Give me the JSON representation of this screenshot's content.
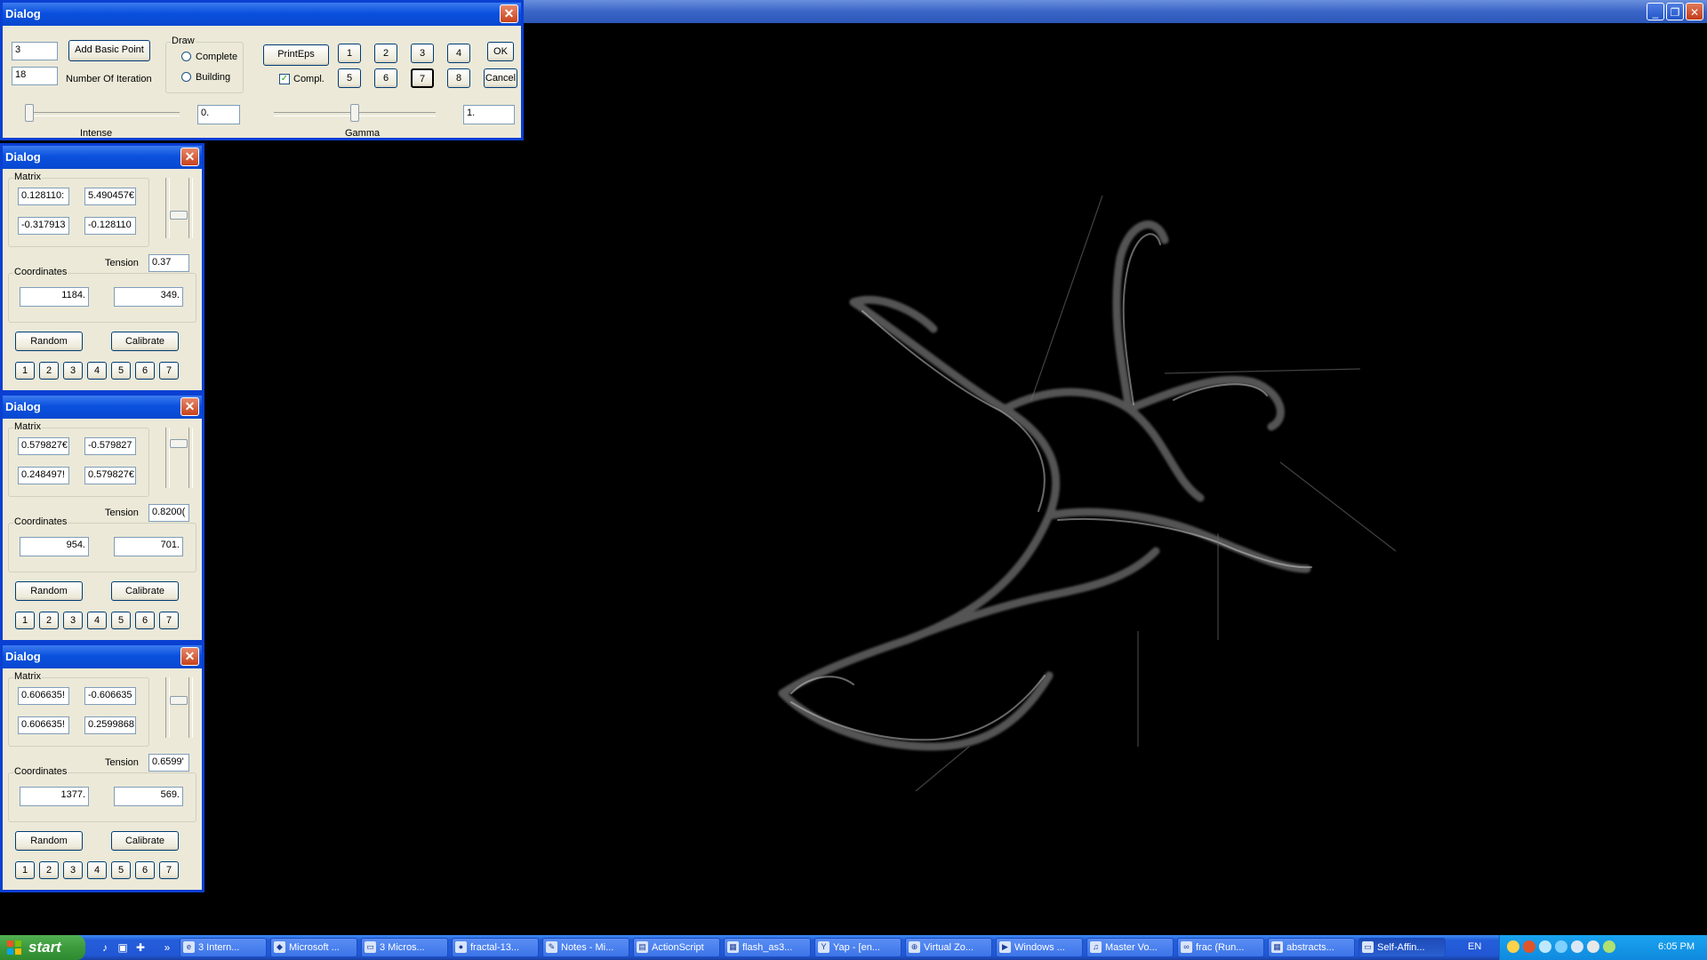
{
  "main_window": {
    "buttons": [
      "minimize",
      "maximize",
      "close"
    ],
    "minimize_glyph": "_",
    "maximize_glyph": "❐",
    "close_glyph": "✕"
  },
  "top_dialog": {
    "title": "Dialog",
    "basic_points_value": "3",
    "iterations_value": "18",
    "add_basic_point_label": "Add Basic Point",
    "number_of_iteration_label": "Number Of Iteration",
    "draw_group_label": "Draw",
    "complete_label": "Complete",
    "building_label": "Building",
    "print_eps_label": "PrintEps",
    "compl_label": "Compl.",
    "compl_checked": true,
    "number_buttons": [
      "1",
      "2",
      "3",
      "4",
      "5",
      "6",
      "7",
      "8"
    ],
    "pressed_number": "7",
    "ok_label": "OK",
    "cancel_label": "Cancel",
    "intense_value": "0.",
    "intense_label": "Intense",
    "intense_level": 0.0,
    "gamma_value": "1.",
    "gamma_label": "Gamma",
    "gamma_level": 0.5
  },
  "side_dialogs": [
    {
      "title": "Dialog",
      "matrix_label": "Matrix",
      "m11": "0.128110:",
      "m12": "5.490457€",
      "m21": "-0.317913",
      "m22": "-0.128110",
      "tension_label": "Tension",
      "tension": "0.37",
      "coordinates_label": "Coordinates",
      "x": "1184.",
      "y": "349.",
      "random_label": "Random",
      "calibrate_label": "Calibrate",
      "numbers": [
        "1",
        "2",
        "3",
        "4",
        "5",
        "6",
        "7"
      ],
      "slider_level": 0.63
    },
    {
      "title": "Dialog",
      "matrix_label": "Matrix",
      "m11": "0.579827€",
      "m12": "-0.579827",
      "m21": "0.248497!",
      "m22": "0.579827€",
      "tension_label": "Tension",
      "tension": "0.8200(",
      "coordinates_label": "Coordinates",
      "x": "954.",
      "y": "701.",
      "random_label": "Random",
      "calibrate_label": "Calibrate",
      "numbers": [
        "1",
        "2",
        "3",
        "4",
        "5",
        "6",
        "7"
      ],
      "slider_level": 0.22
    },
    {
      "title": "Dialog",
      "matrix_label": "Matrix",
      "m11": "0.606635!",
      "m12": "-0.606635",
      "m21": "0.606635!",
      "m22": "0.2599868",
      "tension_label": "Tension",
      "tension": "0.6599'",
      "coordinates_label": "Coordinates",
      "x": "1377.",
      "y": "569.",
      "random_label": "Random",
      "calibrate_label": "Calibrate",
      "numbers": [
        "1",
        "2",
        "3",
        "4",
        "5",
        "6",
        "7"
      ],
      "slider_level": 0.37
    }
  ],
  "taskbar": {
    "start_label": "start",
    "quicklaunch": [
      "media-icon",
      "desktop-icon",
      "app-icon",
      "more-icon"
    ],
    "tasks": [
      {
        "label": "3 Intern...",
        "icon": "ie-icon"
      },
      {
        "label": "Microsoft ...",
        "icon": "app-icon"
      },
      {
        "label": "3 Micros...",
        "icon": "window-icon"
      },
      {
        "label": "fractal-13...",
        "icon": "firefox-icon"
      },
      {
        "label": "Notes - Mi...",
        "icon": "notes-icon"
      },
      {
        "label": "ActionScript",
        "icon": "folder-icon"
      },
      {
        "label": "flash_as3...",
        "icon": "doc-icon"
      },
      {
        "label": "Yap - [en...",
        "icon": "yap-icon"
      },
      {
        "label": "Virtual Zo...",
        "icon": "zoom-icon"
      },
      {
        "label": "Windows ...",
        "icon": "media-icon"
      },
      {
        "label": "Master Vo...",
        "icon": "volume-icon"
      },
      {
        "label": "frac (Run...",
        "icon": "run-icon"
      },
      {
        "label": "abstracts...",
        "icon": "doc-icon"
      },
      {
        "label": "Self-Affin...",
        "icon": "window-icon",
        "active": true
      }
    ],
    "language": "EN",
    "clock": "6:05 PM"
  }
}
